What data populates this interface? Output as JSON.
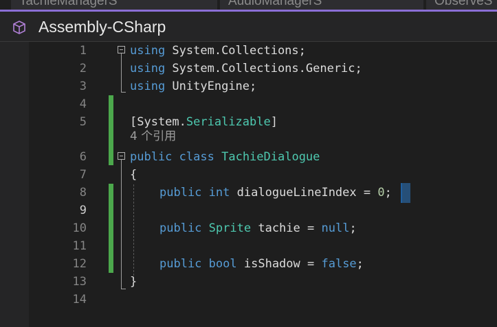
{
  "tabs": [
    {
      "label": "TachieManagerS"
    },
    {
      "label": "AudioManagerS"
    },
    {
      "label": "ObserveS"
    }
  ],
  "colors": {
    "accent": "#8b6fd6",
    "keyword": "#569cd6",
    "type": "#4ec9b0",
    "number": "#b5cea8",
    "change_bar": "#4ca84c"
  },
  "project": {
    "icon": "csharp-project-icon",
    "title": "Assembly-CSharp"
  },
  "editor": {
    "line_numbers": [
      "1",
      "2",
      "3",
      "4",
      "5",
      "6",
      "7",
      "8",
      "9",
      "10",
      "11",
      "12",
      "13",
      "14"
    ],
    "current_line": "9",
    "lines": {
      "l1": {
        "kw": "using",
        "rest": " System.Collections;"
      },
      "l2": {
        "kw": "using",
        "rest": " System.Collections.Generic;"
      },
      "l3": {
        "kw": "using",
        "rest": " UnityEngine;"
      },
      "l5": {
        "open": "[System.",
        "type": "Serializable",
        "close": "]"
      },
      "codelens": "4 个引用",
      "l6": {
        "kw1": "public",
        "kw2": "class",
        "type": "TachieDialogue"
      },
      "l7": {
        "text": "{"
      },
      "l8": {
        "kw1": "public",
        "kw2": "int",
        "name": "dialogueLineIndex",
        "eq": " = ",
        "num": "0",
        "end": ";"
      },
      "l10": {
        "kw1": "public",
        "type": "Sprite",
        "name": "tachie",
        "eq": " = ",
        "val": "null",
        "end": ";"
      },
      "l12": {
        "kw1": "public",
        "kw2": "bool",
        "name": "isShadow",
        "eq": " = ",
        "val": "false",
        "end": ";"
      },
      "l13": {
        "text": "}"
      }
    }
  }
}
